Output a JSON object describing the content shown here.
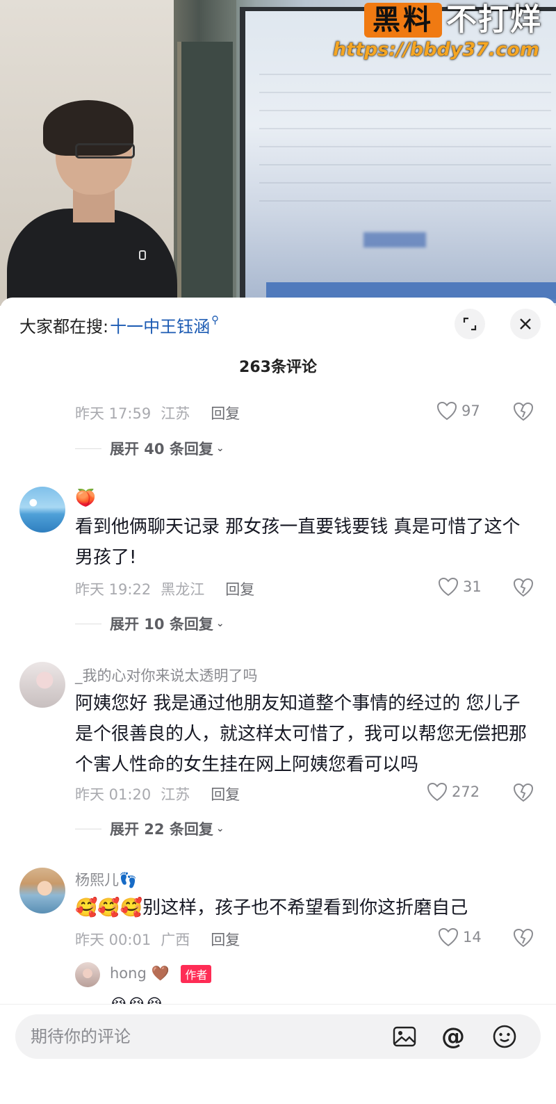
{
  "watermark": {
    "tag": "黑料",
    "tag2": "不打烊",
    "url": "https://bbdy37.com"
  },
  "panel": {
    "search_prefix": "大家都在搜:",
    "search_keyword": "十一中王钰涵",
    "title": "263条评论"
  },
  "comments": [
    {
      "time": "昨天 17:59",
      "location": "江苏",
      "reply_label": "回复",
      "likes": "97",
      "expand_label": "展开 40 条回复"
    },
    {
      "username": "🍑",
      "text": "看到他俩聊天记录 那女孩一直要钱要钱 真是可惜了这个男孩了!",
      "time": "昨天 19:22",
      "location": "黑龙江",
      "reply_label": "回复",
      "likes": "31",
      "expand_label": "展开 10 条回复"
    },
    {
      "username": "_我的心对你来说太透明了吗",
      "text": "阿姨您好 我是通过他朋友知道整个事情的经过的 您儿子是个很善良的人，就这样太可惜了，我可以帮您无偿把那个害人性命的女生挂在网上阿姨您看可以吗",
      "time": "昨天 01:20",
      "location": "江苏",
      "reply_label": "回复",
      "likes": "272",
      "expand_label": "展开 22 条回复"
    },
    {
      "username": "杨熙儿👣",
      "text": "🥰🥰🥰别这样，孩子也不希望看到你这折磨自己",
      "time": "昨天 00:01",
      "location": "广西",
      "reply_label": "回复",
      "likes": "14"
    }
  ],
  "sub_reply": {
    "username": "hong 🤎",
    "author_tag": "作者",
    "text": "😭😭😭"
  },
  "input": {
    "placeholder": "期待你的评论"
  },
  "icons": {
    "expand": "expand-icon",
    "close": "close-icon",
    "like": "heart-outline-icon",
    "dislike": "broken-heart-icon",
    "image": "image-icon",
    "mention": "at-icon",
    "emoji": "emoji-icon"
  },
  "colors": {
    "keyword": "#1c5bb3",
    "author_tag": "#fe2c55",
    "watermark_tag": "#f07a12",
    "watermark_url": "#f5a623"
  }
}
